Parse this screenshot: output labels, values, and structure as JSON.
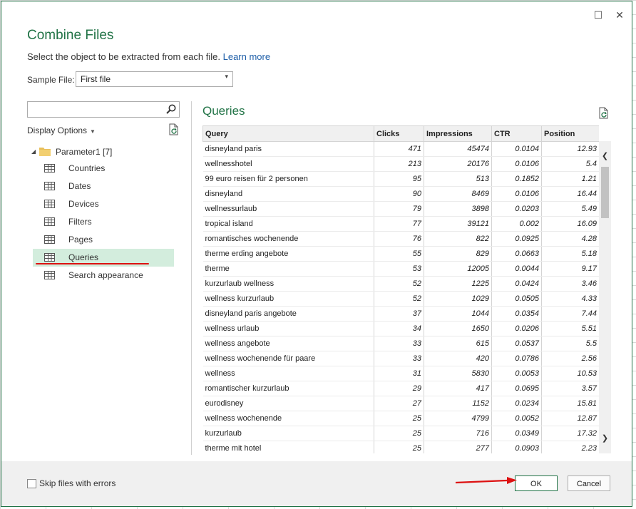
{
  "dialog": {
    "title": "Combine Files",
    "subtitle": "Select the object to be extracted from each file.",
    "learn_more": "Learn more",
    "sample_file_label": "Sample File:",
    "sample_file_value": "First file"
  },
  "sidebar": {
    "search_placeholder": "",
    "display_options": "Display Options",
    "folder": {
      "name": "Parameter1",
      "count": "[7]"
    },
    "items": [
      {
        "label": "Countries"
      },
      {
        "label": "Dates"
      },
      {
        "label": "Devices"
      },
      {
        "label": "Filters"
      },
      {
        "label": "Pages"
      },
      {
        "label": "Queries"
      },
      {
        "label": "Search appearance"
      }
    ]
  },
  "preview": {
    "title": "Queries",
    "columns": [
      "Query",
      "Clicks",
      "Impressions",
      "CTR",
      "Position"
    ],
    "rows": [
      [
        "disneyland paris",
        "471",
        "45474",
        "0.0104",
        "12.93"
      ],
      [
        "wellnesshotel",
        "213",
        "20176",
        "0.0106",
        "5.4"
      ],
      [
        "99 euro reisen für 2 personen",
        "95",
        "513",
        "0.1852",
        "1.21"
      ],
      [
        "disneyland",
        "90",
        "8469",
        "0.0106",
        "16.44"
      ],
      [
        "wellnessurlaub",
        "79",
        "3898",
        "0.0203",
        "5.49"
      ],
      [
        "tropical island",
        "77",
        "39121",
        "0.002",
        "16.09"
      ],
      [
        "romantisches wochenende",
        "76",
        "822",
        "0.0925",
        "4.28"
      ],
      [
        "therme erding angebote",
        "55",
        "829",
        "0.0663",
        "5.18"
      ],
      [
        "therme",
        "53",
        "12005",
        "0.0044",
        "9.17"
      ],
      [
        "kurzurlaub wellness",
        "52",
        "1225",
        "0.0424",
        "3.46"
      ],
      [
        "wellness kurzurlaub",
        "52",
        "1029",
        "0.0505",
        "4.33"
      ],
      [
        "disneyland paris angebote",
        "37",
        "1044",
        "0.0354",
        "7.44"
      ],
      [
        "wellness urlaub",
        "34",
        "1650",
        "0.0206",
        "5.51"
      ],
      [
        "wellness angebote",
        "33",
        "615",
        "0.0537",
        "5.5"
      ],
      [
        "wellness wochenende für paare",
        "33",
        "420",
        "0.0786",
        "2.56"
      ],
      [
        "wellness",
        "31",
        "5830",
        "0.0053",
        "10.53"
      ],
      [
        "romantischer kurzurlaub",
        "29",
        "417",
        "0.0695",
        "3.57"
      ],
      [
        "eurodisney",
        "27",
        "1152",
        "0.0234",
        "15.81"
      ],
      [
        "wellness wochenende",
        "25",
        "4799",
        "0.0052",
        "12.87"
      ],
      [
        "kurzurlaub",
        "25",
        "716",
        "0.0349",
        "17.32"
      ],
      [
        "therme mit hotel",
        "25",
        "277",
        "0.0903",
        "2.23"
      ]
    ]
  },
  "footer": {
    "skip_label": "Skip files with errors",
    "ok": "OK",
    "cancel": "Cancel"
  },
  "colors": {
    "accent": "#217346",
    "annotation": "#dd1111",
    "selected": "#d3eddd"
  }
}
